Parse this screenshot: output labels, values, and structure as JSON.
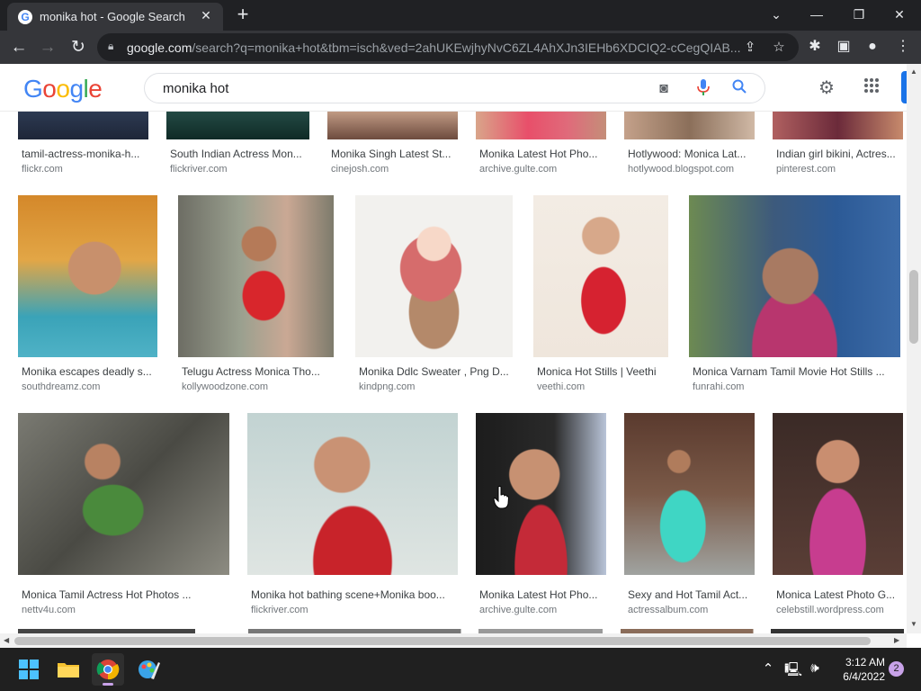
{
  "browser": {
    "tab_title": "monika hot - Google Search",
    "tab_close_icon": "close-icon",
    "new_tab_icon": "plus-icon",
    "window_controls": [
      "chevron-down-icon",
      "minimize-icon",
      "restore-icon",
      "close-icon"
    ],
    "url_host": "google.com",
    "url_rest": "/search?q=monika+hot&tbm=isch&ved=2ahUKEwjhyNvC6ZL4AhXJn3IEHb6XDCIQ2-cCegQIAB...",
    "toolbar_icons": [
      "share-icon",
      "star-icon",
      "extensions-icon",
      "sidepanel-icon",
      "profile-icon",
      "menu-icon"
    ]
  },
  "google": {
    "logo": "Google",
    "query": "monika hot",
    "colors": {
      "blue": "#4285f4",
      "red": "#ea4335",
      "yellow": "#fbbc05",
      "green": "#34a853"
    }
  },
  "results": {
    "row1": [
      {
        "caption": "tamil-actress-monika-h...",
        "source": "flickr.com"
      },
      {
        "caption": "South Indian Actress Mon...",
        "source": "flickriver.com"
      },
      {
        "caption": "Monika Singh Latest St...",
        "source": "cinejosh.com"
      },
      {
        "caption": "Monika Latest Hot Pho...",
        "source": "archive.gulte.com"
      },
      {
        "caption": "Hotlywood: Monica Lat...",
        "source": "hotlywood.blogspot.com"
      },
      {
        "caption": "Indian girl bikini, Actres...",
        "source": "pinterest.com"
      }
    ],
    "row2": [
      {
        "caption": "Monika escapes deadly s...",
        "source": "southdreamz.com"
      },
      {
        "caption": "Telugu Actress Monica Tho...",
        "source": "kollywoodzone.com"
      },
      {
        "caption": "Monika Ddlc Sweater , Png D...",
        "source": "kindpng.com"
      },
      {
        "caption": "Monica Hot Stills | Veethi",
        "source": "veethi.com"
      },
      {
        "caption": "Monica Varnam Tamil Movie Hot Stills ...",
        "source": "funrahi.com"
      }
    ],
    "row3": [
      {
        "caption": "Monica Tamil Actress Hot Photos ...",
        "source": "nettv4u.com"
      },
      {
        "caption": "Monika hot bathing scene+Monika boo...",
        "source": "flickriver.com"
      },
      {
        "caption": "Monika Latest Hot Pho...",
        "source": "archive.gulte.com"
      },
      {
        "caption": "Sexy and Hot Tamil Act...",
        "source": "actressalbum.com"
      },
      {
        "caption": "Monica Latest Photo G...",
        "source": "celebstill.wordpress.com"
      }
    ]
  },
  "taskbar": {
    "apps": [
      "windows-start-icon",
      "file-explorer-icon",
      "chrome-icon",
      "paint-icon"
    ],
    "time": "3:12 AM",
    "date": "6/4/2022",
    "notifications": "2"
  }
}
